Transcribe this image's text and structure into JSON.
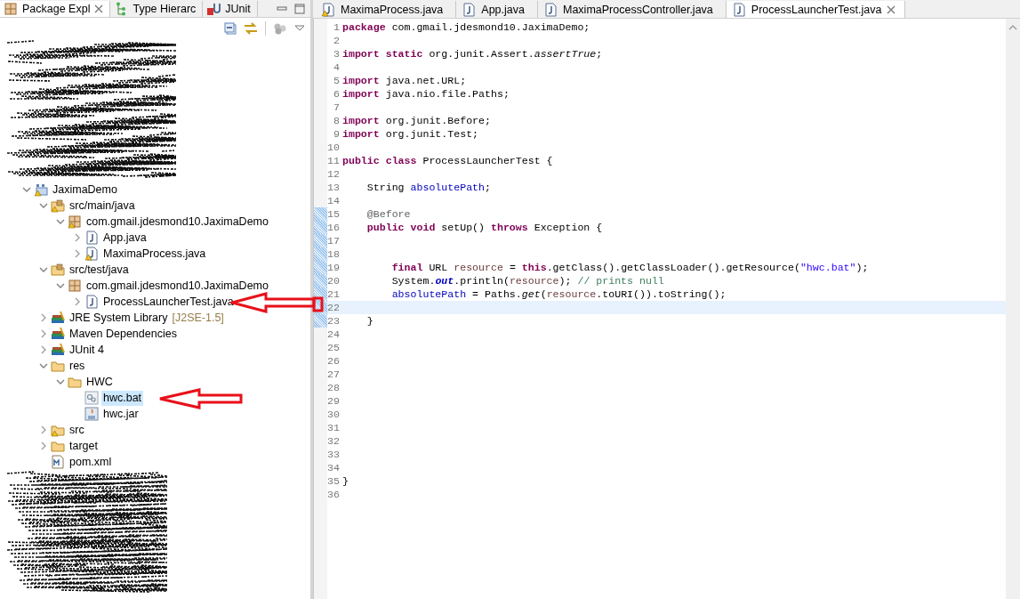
{
  "package_explorer": {
    "tabs": [
      {
        "label": "Package Expl",
        "kind": "package",
        "selected": true
      },
      {
        "label": "Type Hierarc",
        "kind": "hierarchy",
        "selected": false
      },
      {
        "label": "JUnit",
        "kind": "junit",
        "selected": false
      }
    ],
    "tree": [
      {
        "label": "JaximaDemo",
        "kind": "project",
        "warning": true,
        "expanded": true,
        "selected": false,
        "children": [
          {
            "label": "src/main/java",
            "kind": "source-folder",
            "warning": true,
            "expanded": true,
            "selected": false,
            "children": [
              {
                "label": "com.gmail.jdesmond10.JaximaDemo",
                "kind": "package",
                "warning": true,
                "expanded": true,
                "selected": false,
                "children": [
                  {
                    "label": "App.java",
                    "kind": "java-file",
                    "warning": false,
                    "expanded": false,
                    "selected": false
                  },
                  {
                    "label": "MaximaProcess.java",
                    "kind": "java-file",
                    "warning": true,
                    "expanded": false,
                    "selected": false
                  }
                ]
              }
            ]
          },
          {
            "label": "src/test/java",
            "kind": "source-folder",
            "warning": false,
            "expanded": true,
            "selected": false,
            "children": [
              {
                "label": "com.gmail.jdesmond10.JaximaDemo",
                "kind": "package",
                "warning": false,
                "expanded": true,
                "selected": false,
                "children": [
                  {
                    "label": "ProcessLauncherTest.java",
                    "kind": "java-file",
                    "warning": false,
                    "expanded": false,
                    "selected": false
                  }
                ]
              }
            ]
          },
          {
            "label": "JRE System Library",
            "decoration": "[J2SE-1.5]",
            "kind": "library",
            "warning": false,
            "expanded": false,
            "selected": false
          },
          {
            "label": "Maven Dependencies",
            "kind": "library",
            "warning": false,
            "expanded": false,
            "selected": false
          },
          {
            "label": "JUnit 4",
            "kind": "library",
            "warning": false,
            "expanded": false,
            "selected": false
          },
          {
            "label": "res",
            "kind": "folder",
            "warning": false,
            "expanded": true,
            "selected": false,
            "children": [
              {
                "label": "HWC",
                "kind": "folder",
                "warning": false,
                "expanded": true,
                "selected": false,
                "children": [
                  {
                    "label": "hwc.bat",
                    "kind": "bat-file",
                    "warning": false,
                    "selected": true
                  },
                  {
                    "label": "hwc.jar",
                    "kind": "jar-file",
                    "warning": false,
                    "selected": false
                  }
                ]
              }
            ]
          },
          {
            "label": "src",
            "kind": "folder",
            "warning": true,
            "expanded": false,
            "selected": false
          },
          {
            "label": "target",
            "kind": "folder",
            "warning": false,
            "expanded": false,
            "selected": false
          },
          {
            "label": "pom.xml",
            "kind": "xml-file",
            "warning": false,
            "selected": false
          }
        ]
      }
    ]
  },
  "editor": {
    "tabs": [
      {
        "label": "MaximaProcess.java",
        "warning": true,
        "selected": false
      },
      {
        "label": "App.java",
        "warning": false,
        "selected": false
      },
      {
        "label": "MaximaProcessController.java",
        "warning": false,
        "selected": false
      },
      {
        "label": "ProcessLauncherTest.java",
        "warning": false,
        "selected": true
      }
    ],
    "lines": [
      {
        "number": "1",
        "changed": false,
        "current": false,
        "segments": [
          {
            "kind": "keyword",
            "text": "package"
          },
          {
            "kind": "plain",
            "text": " com.gmail.jdesmond10.JaximaDemo;"
          }
        ]
      },
      {
        "number": "2",
        "changed": false,
        "current": false
      },
      {
        "number": "3",
        "changed": false,
        "current": false,
        "segments": [
          {
            "kind": "keyword",
            "text": "import static"
          },
          {
            "kind": "plain",
            "text": " org.junit.Assert."
          },
          {
            "kind": "static-method",
            "text": "assertTrue"
          },
          {
            "kind": "plain",
            "text": ";"
          }
        ]
      },
      {
        "number": "4",
        "changed": false,
        "current": false
      },
      {
        "number": "5",
        "changed": false,
        "current": false,
        "segments": [
          {
            "kind": "keyword",
            "text": "import"
          },
          {
            "kind": "plain",
            "text": " java.net.URL;"
          }
        ]
      },
      {
        "number": "6",
        "changed": false,
        "current": false,
        "segments": [
          {
            "kind": "keyword",
            "text": "import"
          },
          {
            "kind": "plain",
            "text": " java.nio.file.Paths;"
          }
        ]
      },
      {
        "number": "7",
        "changed": false,
        "current": false
      },
      {
        "number": "8",
        "changed": false,
        "current": false,
        "segments": [
          {
            "kind": "keyword",
            "text": "import"
          },
          {
            "kind": "plain",
            "text": " org.junit.Before;"
          }
        ]
      },
      {
        "number": "9",
        "changed": false,
        "current": false,
        "segments": [
          {
            "kind": "keyword",
            "text": "import"
          },
          {
            "kind": "plain",
            "text": " org.junit.Test;"
          }
        ]
      },
      {
        "number": "10",
        "changed": false,
        "current": false
      },
      {
        "number": "11",
        "changed": false,
        "current": false,
        "segments": [
          {
            "kind": "keyword",
            "text": "public class"
          },
          {
            "kind": "plain",
            "text": " ProcessLauncherTest {"
          }
        ]
      },
      {
        "number": "12",
        "changed": false,
        "current": false
      },
      {
        "number": "13",
        "changed": false,
        "current": false,
        "segments": [
          {
            "kind": "plain",
            "text": "    String "
          },
          {
            "kind": "field",
            "text": "absolutePath"
          },
          {
            "kind": "plain",
            "text": ";"
          }
        ]
      },
      {
        "number": "14",
        "changed": false,
        "current": false
      },
      {
        "number": "15",
        "changed": true,
        "current": false,
        "segments": [
          {
            "kind": "annotation",
            "text": "    @Before"
          }
        ]
      },
      {
        "number": "16",
        "changed": true,
        "current": false,
        "segments": [
          {
            "kind": "keyword",
            "text": "    public void"
          },
          {
            "kind": "plain",
            "text": " setUp() "
          },
          {
            "kind": "keyword",
            "text": "throws"
          },
          {
            "kind": "plain",
            "text": " Exception {"
          }
        ]
      },
      {
        "number": "17",
        "changed": true,
        "current": false
      },
      {
        "number": "18",
        "changed": true,
        "current": false
      },
      {
        "number": "19",
        "changed": true,
        "current": false,
        "segments": [
          {
            "kind": "keyword",
            "text": "        final"
          },
          {
            "kind": "plain",
            "text": " URL "
          },
          {
            "kind": "local",
            "text": "resource"
          },
          {
            "kind": "plain",
            "text": " = "
          },
          {
            "kind": "keyword",
            "text": "this"
          },
          {
            "kind": "plain",
            "text": ".getClass().getClassLoader().getResource("
          },
          {
            "kind": "string",
            "text": "\"hwc.bat\""
          },
          {
            "kind": "plain",
            "text": ");"
          }
        ]
      },
      {
        "number": "20",
        "changed": true,
        "current": false,
        "segments": [
          {
            "kind": "plain",
            "text": "        System."
          },
          {
            "kind": "static-field",
            "text": "out"
          },
          {
            "kind": "plain",
            "text": ".println("
          },
          {
            "kind": "local",
            "text": "resource"
          },
          {
            "kind": "plain",
            "text": "); "
          },
          {
            "kind": "comment",
            "text": "// prints null"
          }
        ]
      },
      {
        "number": "21",
        "changed": true,
        "current": false,
        "segments": [
          {
            "kind": "field",
            "text": "        absolutePath"
          },
          {
            "kind": "plain",
            "text": " = Paths."
          },
          {
            "kind": "static-method",
            "text": "get"
          },
          {
            "kind": "plain",
            "text": "("
          },
          {
            "kind": "local",
            "text": "resource"
          },
          {
            "kind": "plain",
            "text": ".toURI()).toString();"
          }
        ]
      },
      {
        "number": "22",
        "changed": true,
        "current": true
      },
      {
        "number": "23",
        "changed": true,
        "current": false,
        "segments": [
          {
            "kind": "plain",
            "text": "    }"
          }
        ]
      },
      {
        "number": "24",
        "changed": false,
        "current": false
      },
      {
        "number": "25",
        "changed": false,
        "current": false
      },
      {
        "number": "26",
        "changed": false,
        "current": false
      },
      {
        "number": "27",
        "changed": false,
        "current": false
      },
      {
        "number": "28",
        "changed": false,
        "current": false
      },
      {
        "number": "29",
        "changed": false,
        "current": false
      },
      {
        "number": "30",
        "changed": false,
        "current": false
      },
      {
        "number": "31",
        "changed": false,
        "current": false
      },
      {
        "number": "32",
        "changed": false,
        "current": false
      },
      {
        "number": "33",
        "changed": false,
        "current": false
      },
      {
        "number": "34",
        "changed": false,
        "current": false
      },
      {
        "number": "35",
        "changed": false,
        "current": false,
        "segments": [
          {
            "kind": "plain",
            "text": "}"
          }
        ]
      },
      {
        "number": "36",
        "changed": false,
        "current": false
      }
    ]
  }
}
